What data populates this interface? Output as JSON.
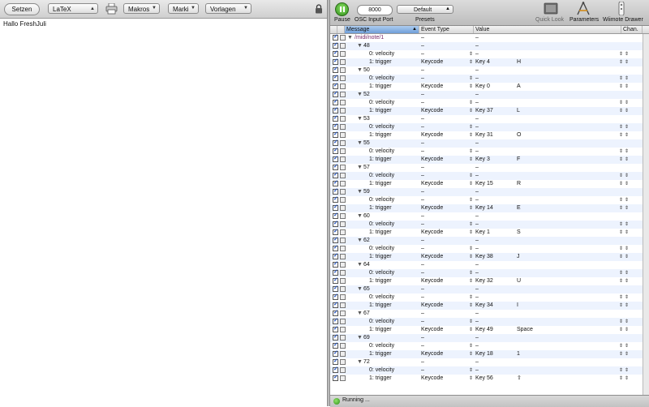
{
  "editor": {
    "toolbar": {
      "setzen_label": "Setzen",
      "format_value": "LaTeX",
      "makros_label": "Makros",
      "marken_label": "Marki",
      "vorlagen_label": "Vorlagen"
    },
    "content": "Hallo FreshJuli"
  },
  "osculator": {
    "toolbar": {
      "pause_label": "Pause",
      "port_value": "8000",
      "port_label": "OSC Input Port",
      "presets_value": "Default",
      "presets_label": "Presets",
      "quicklook_label": "Quick Look",
      "parameters_label": "Parameters",
      "wiimote_label": "Wiimote Drawer"
    },
    "columns": {
      "message": "Message",
      "event_type": "Event Type",
      "value": "Value",
      "channel": "Chan."
    },
    "root": {
      "message": "/midi/note/1",
      "event": "–",
      "value": "–"
    },
    "groups": [
      {
        "note": "48",
        "key": "Key 4",
        "char": "H"
      },
      {
        "note": "50",
        "key": "Key 0",
        "char": "A"
      },
      {
        "note": "52",
        "key": "Key 37",
        "char": "L"
      },
      {
        "note": "53",
        "key": "Key 31",
        "char": "O"
      },
      {
        "note": "55",
        "key": "Key 3",
        "char": "F"
      },
      {
        "note": "57",
        "key": "Key 15",
        "char": "R"
      },
      {
        "note": "59",
        "key": "Key 14",
        "char": "E"
      },
      {
        "note": "60",
        "key": "Key 1",
        "char": "S"
      },
      {
        "note": "62",
        "key": "Key 38",
        "char": "J"
      },
      {
        "note": "64",
        "key": "Key 32",
        "char": "U"
      },
      {
        "note": "65",
        "key": "Key 34",
        "char": "I"
      },
      {
        "note": "67",
        "key": "Key 49",
        "char": "Space"
      },
      {
        "note": "69",
        "key": "Key 18",
        "char": "1"
      },
      {
        "note": "72",
        "key": "Key 56",
        "char": "⇧"
      }
    ],
    "sub_rows": {
      "velocity_label": "0: velocity",
      "trigger_label": "1: trigger",
      "keycode_label": "Keycode",
      "dash": "–"
    },
    "status": "Running ..."
  }
}
